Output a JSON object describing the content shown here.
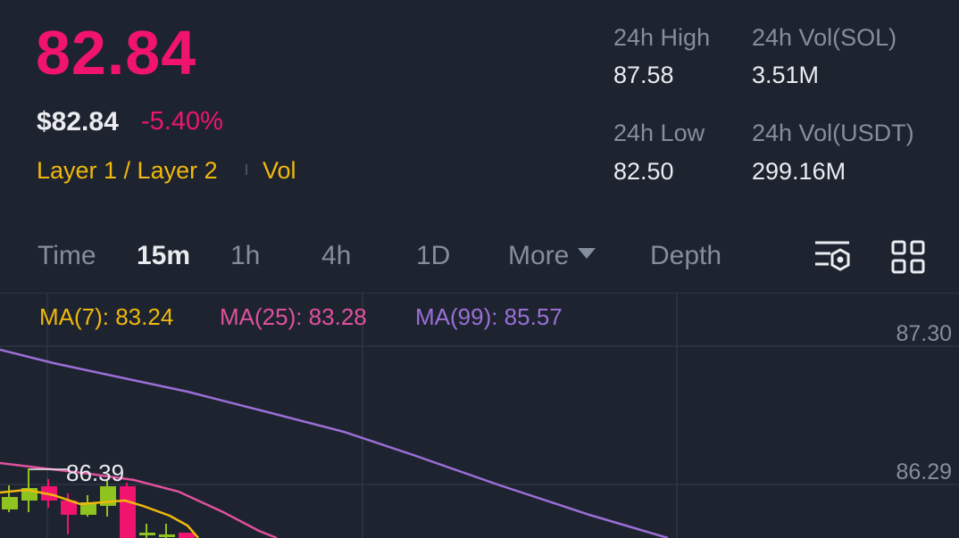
{
  "header": {
    "last_price": "82.84",
    "usd_price": "$82.84",
    "change_pct": "-5.40%",
    "tag_category": "Layer 1 / Layer 2",
    "tag_vol": "Vol"
  },
  "stats": {
    "high_label": "24h High",
    "high_value": "87.58",
    "vol_base_label": "24h Vol(SOL)",
    "vol_base_value": "3.51M",
    "low_label": "24h Low",
    "low_value": "82.50",
    "vol_quote_label": "24h Vol(USDT)",
    "vol_quote_value": "299.16M"
  },
  "tabs": {
    "time": "Time",
    "m15": "15m",
    "h1": "1h",
    "h4": "4h",
    "d1": "1D",
    "more": "More",
    "depth": "Depth",
    "active": "15m"
  },
  "icons": {
    "settings": "chart-settings-icon",
    "layout": "grid-layout-icon"
  },
  "indicators": {
    "ma7": "MA(7): 83.24",
    "ma25": "MA(25): 83.28",
    "ma99": "MA(99): 85.57"
  },
  "chart": {
    "price_axis_top": "87.30",
    "price_axis_mid": "86.29",
    "high_marker": "86.39"
  },
  "colors": {
    "background": "#1e2330",
    "down": "#f0146f",
    "up": "#8fc31f",
    "accent_yellow": "#f0b90b",
    "ma7": "#f0b90b",
    "ma25": "#e0519d",
    "ma99": "#9b6fd6",
    "muted": "#848e9c"
  }
}
